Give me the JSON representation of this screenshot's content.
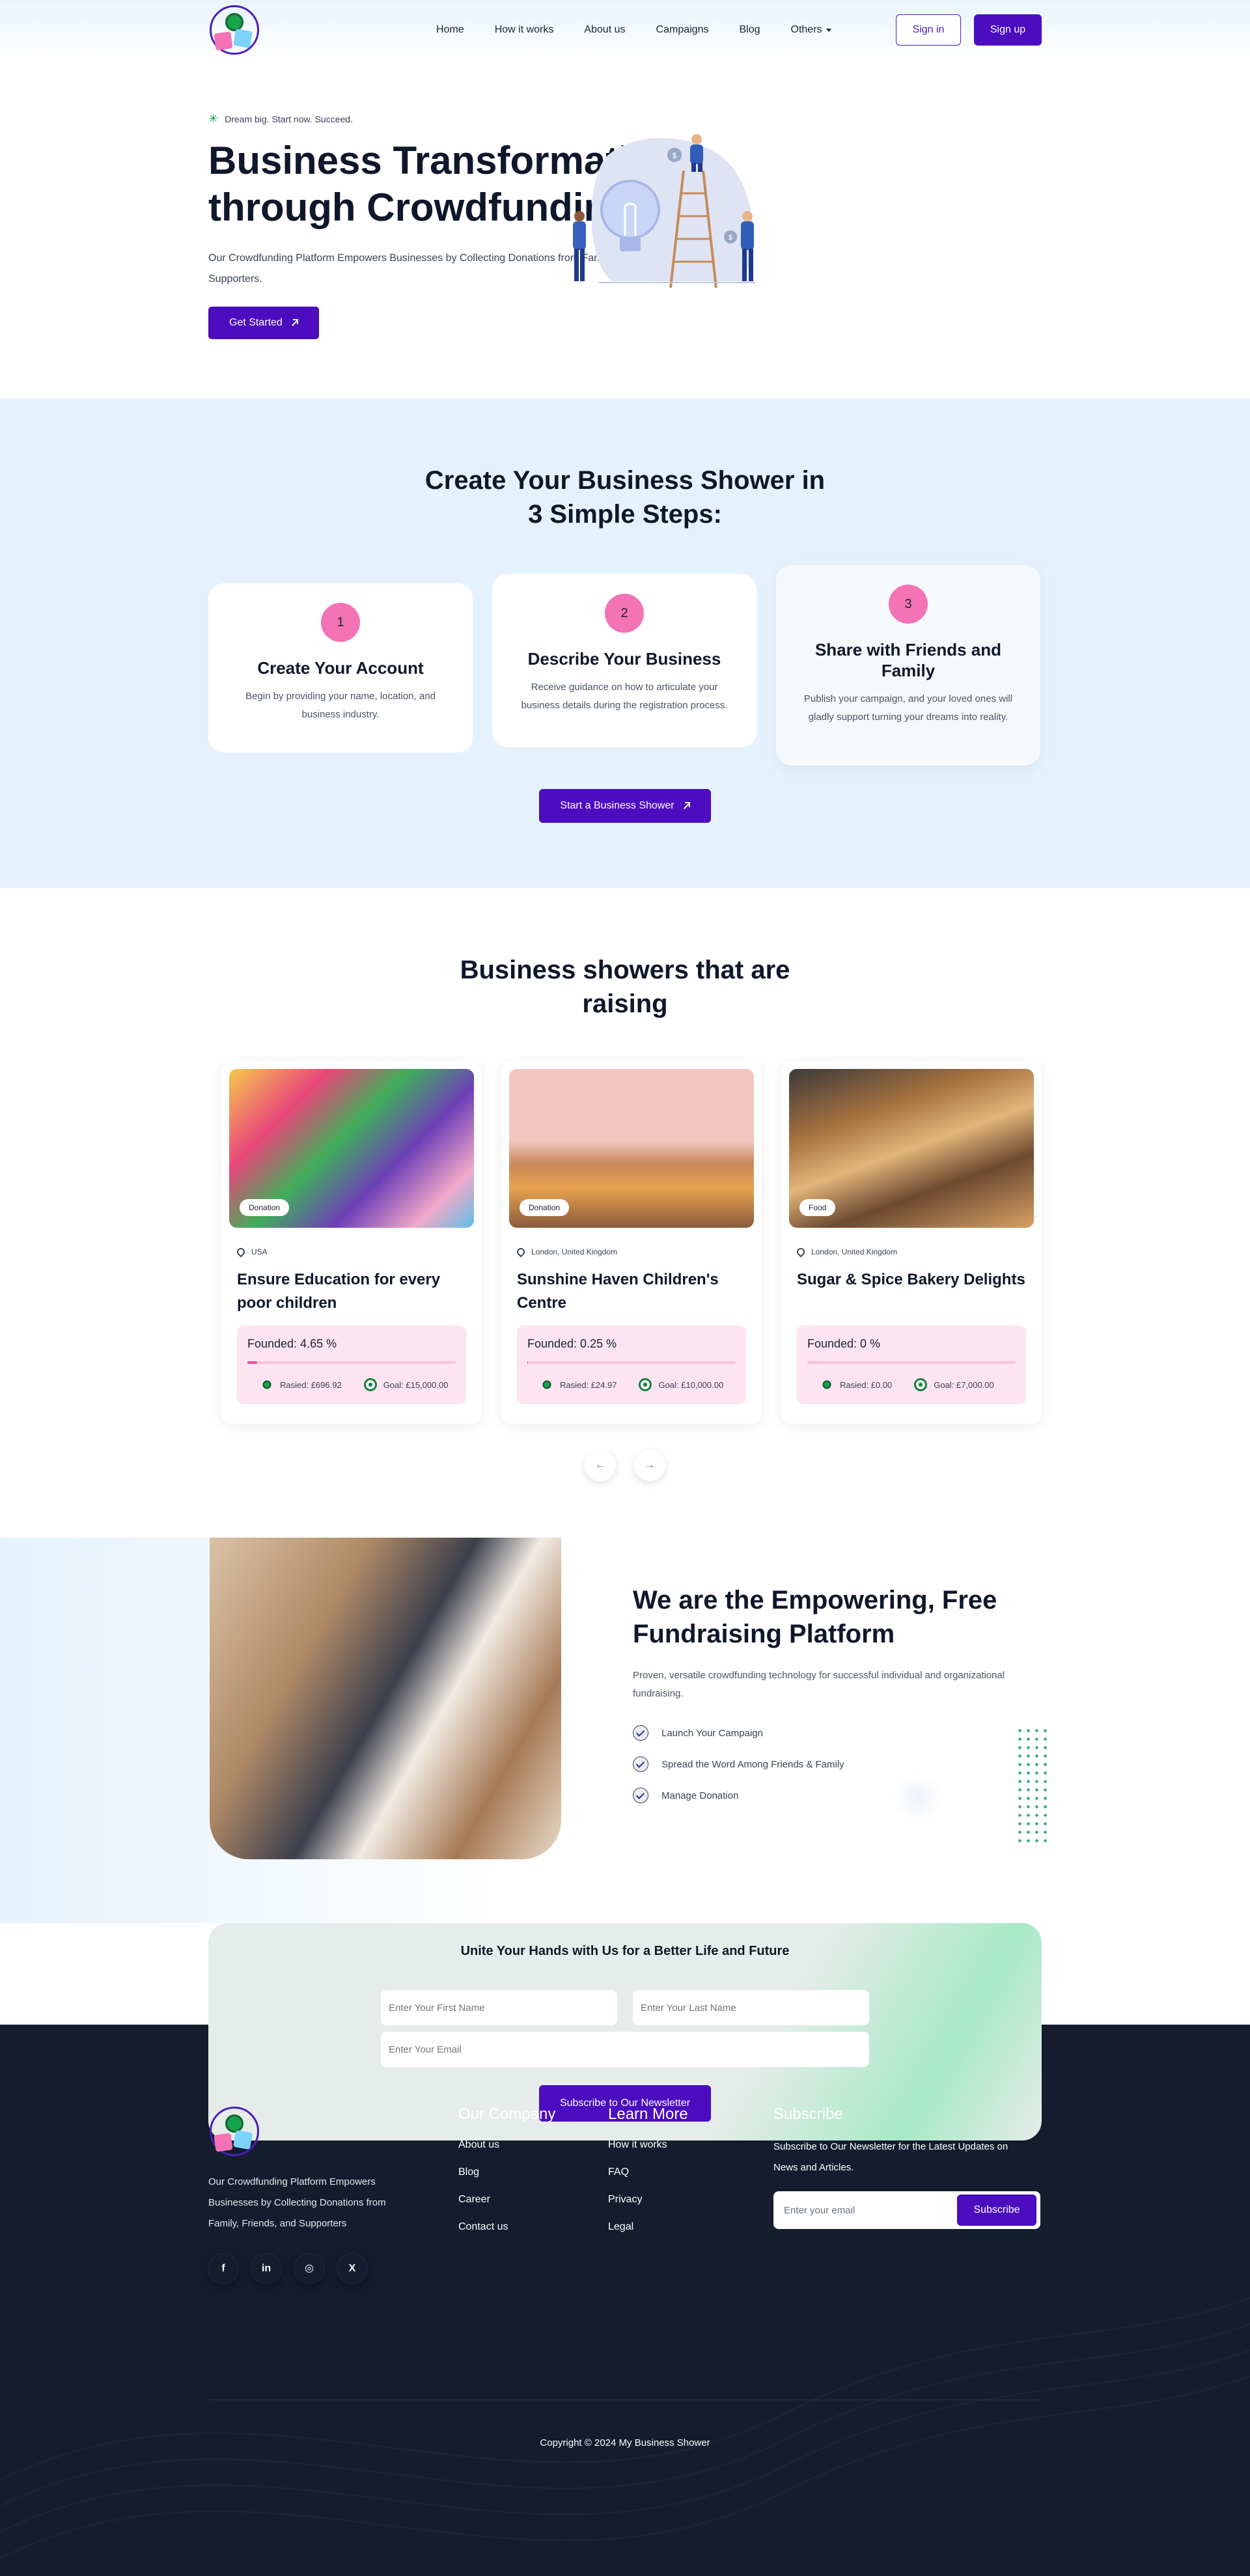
{
  "brand": {
    "logo_text": "My Business Shower"
  },
  "nav": {
    "links": [
      "Home",
      "How it works",
      "About us",
      "Campaigns",
      "Blog",
      "Others"
    ],
    "signin": "Sign in",
    "signup": "Sign up"
  },
  "hero": {
    "tagline": "Dream big. Start now. Succeed.",
    "title": "Business Transformation through Crowdfunding",
    "description": "Our Crowdfunding Platform Empowers Businesses by Collecting Donations from Family, Friends, and Supporters.",
    "cta": "Get Started"
  },
  "steps": {
    "title": "Create Your Business Shower in 3 Simple Steps:",
    "items": [
      {
        "num": "1",
        "title": "Create Your Account",
        "text": "Begin by providing your name, location, and business industry."
      },
      {
        "num": "2",
        "title": "Describe Your Business",
        "text": "Receive guidance on how to articulate your business details during the registration process."
      },
      {
        "num": "3",
        "title": "Share with Friends and Family",
        "text": "Publish your campaign, and your loved ones will gladly support turning your dreams into reality."
      }
    ],
    "cta": "Start a Business Shower"
  },
  "campaigns": {
    "title": "Business showers that are raising",
    "items": [
      {
        "badge": "Donation",
        "location": "USA",
        "title": "Ensure Education for every poor children",
        "founded": "Founded: 4.65 %",
        "progress": 0.0465,
        "raised": "Rasied: £696.92",
        "goal": "Goal: £15,000.00"
      },
      {
        "badge": "Donation",
        "location": "London, United Kingdom",
        "title": "Sunshine Haven Children's Centre",
        "founded": "Founded: 0.25 %",
        "progress": 0.0025,
        "raised": "Rasied: £24.97",
        "goal": "Goal: £10,000.00"
      },
      {
        "badge": "Food",
        "location": "London, United Kingdom",
        "title": "Sugar & Spice Bakery Delights",
        "founded": "Founded: 0 %",
        "progress": 0,
        "raised": "Rasied: £0.00",
        "goal": "Goal: £7,000.00"
      }
    ],
    "prev": "←",
    "next": "→"
  },
  "about": {
    "title": "We are the Empowering, Free Fundraising Platform",
    "text": "Proven, versatile crowdfunding technology for successful individual and organizational fundraising.",
    "checks": [
      "Launch Your Campaign",
      "Spread the Word Among Friends & Family",
      "Manage Donation"
    ]
  },
  "newsletter": {
    "title": "Unite Your Hands with Us for a Better Life and Future",
    "first_placeholder": "Enter Your First Name",
    "last_placeholder": "Enter Your Last Name",
    "email_placeholder": "Enter Your Email",
    "cta": "Subscribe to Our Newsletter"
  },
  "footer": {
    "about": "Our Crowdfunding Platform Empowers Businesses by Collecting Donations from Family, Friends, and Supporters",
    "social": [
      "f",
      "in",
      "◎",
      "X"
    ],
    "company_title": "Our Company",
    "company_links": [
      "About us",
      "Blog",
      "Career",
      "Contact us"
    ],
    "learn_title": "Learn More",
    "learn_links": [
      "How it works",
      "FAQ",
      "Privacy",
      "Legal"
    ],
    "subscribe_title": "Subscribe",
    "subscribe_text": "Subscribe to Our Newsletter for the Latest Updates on News and Articles.",
    "email_placeholder": "Enter your email",
    "subscribe_btn": "Subscribe",
    "copyright": "Copyright © 2024 My Business Shower"
  },
  "colors": {
    "primary": "#4b0dbf",
    "pink": "#f472b6",
    "dark": "#141c2e",
    "light_blue": "#e5f2fd"
  }
}
